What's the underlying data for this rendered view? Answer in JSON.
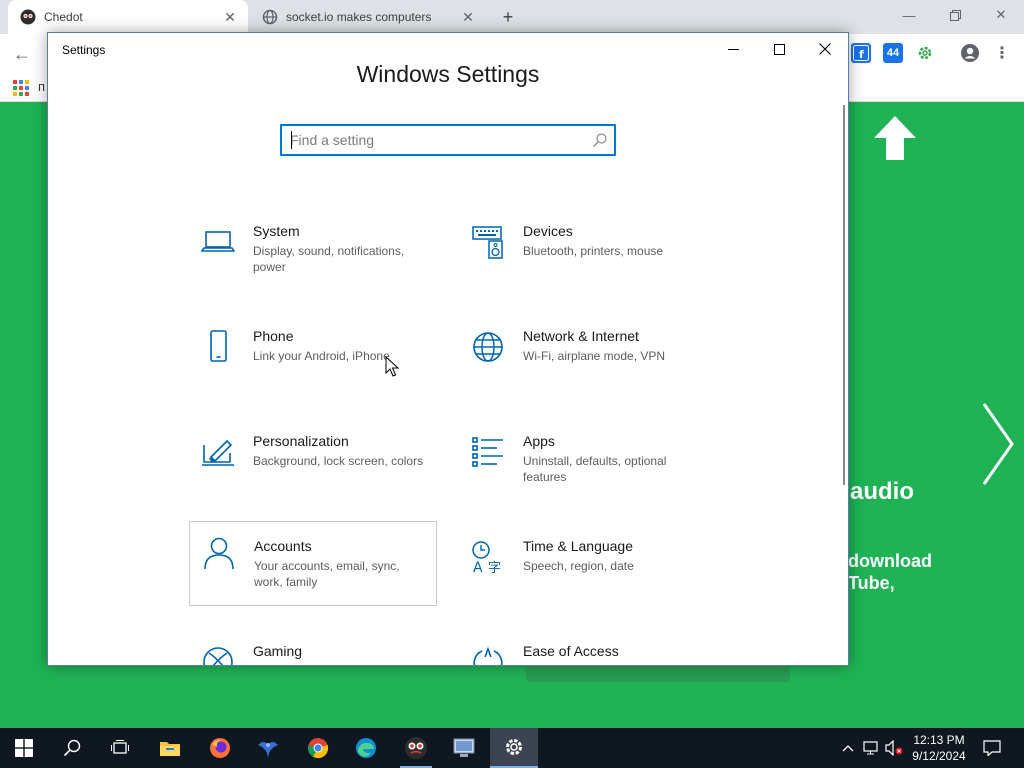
{
  "browser": {
    "tabs": [
      {
        "title": "Chedot",
        "close": "✕"
      },
      {
        "title": "socket.io makes computers",
        "close": "✕"
      }
    ],
    "new_tab": "+",
    "bookmark_partial": "п",
    "ext_badge": "44",
    "page": {
      "heading_partial": "e audio",
      "sub_line1": "download",
      "sub_line2": "Tube,"
    },
    "colors": {
      "page_bg": "#1fb356",
      "accent": "#0078d7"
    }
  },
  "settings": {
    "window_title": "Settings",
    "heading": "Windows Settings",
    "search_placeholder": "Find a setting",
    "tiles": [
      {
        "title": "System",
        "desc": "Display, sound, notifications, power",
        "icon": "laptop-icon"
      },
      {
        "title": "Devices",
        "desc": "Bluetooth, printers, mouse",
        "icon": "keyboard-speaker-icon"
      },
      {
        "title": "Phone",
        "desc": "Link your Android, iPhone",
        "icon": "phone-icon"
      },
      {
        "title": "Network & Internet",
        "desc": "Wi-Fi, airplane mode, VPN",
        "icon": "globe-icon"
      },
      {
        "title": "Personalization",
        "desc": "Background, lock screen, colors",
        "icon": "paint-icon"
      },
      {
        "title": "Apps",
        "desc": "Uninstall, defaults, optional features",
        "icon": "apps-list-icon"
      },
      {
        "title": "Accounts",
        "desc": "Your accounts, email, sync, work, family",
        "icon": "person-icon"
      },
      {
        "title": "Time & Language",
        "desc": "Speech, region, date",
        "icon": "time-language-icon"
      },
      {
        "title": "Gaming",
        "desc": "",
        "icon": "xbox-icon"
      },
      {
        "title": "Ease of Access",
        "desc": "",
        "icon": "ease-of-access-icon"
      }
    ]
  },
  "taskbar": {
    "clock_time": "12:13 PM",
    "clock_date": "9/12/2024"
  }
}
